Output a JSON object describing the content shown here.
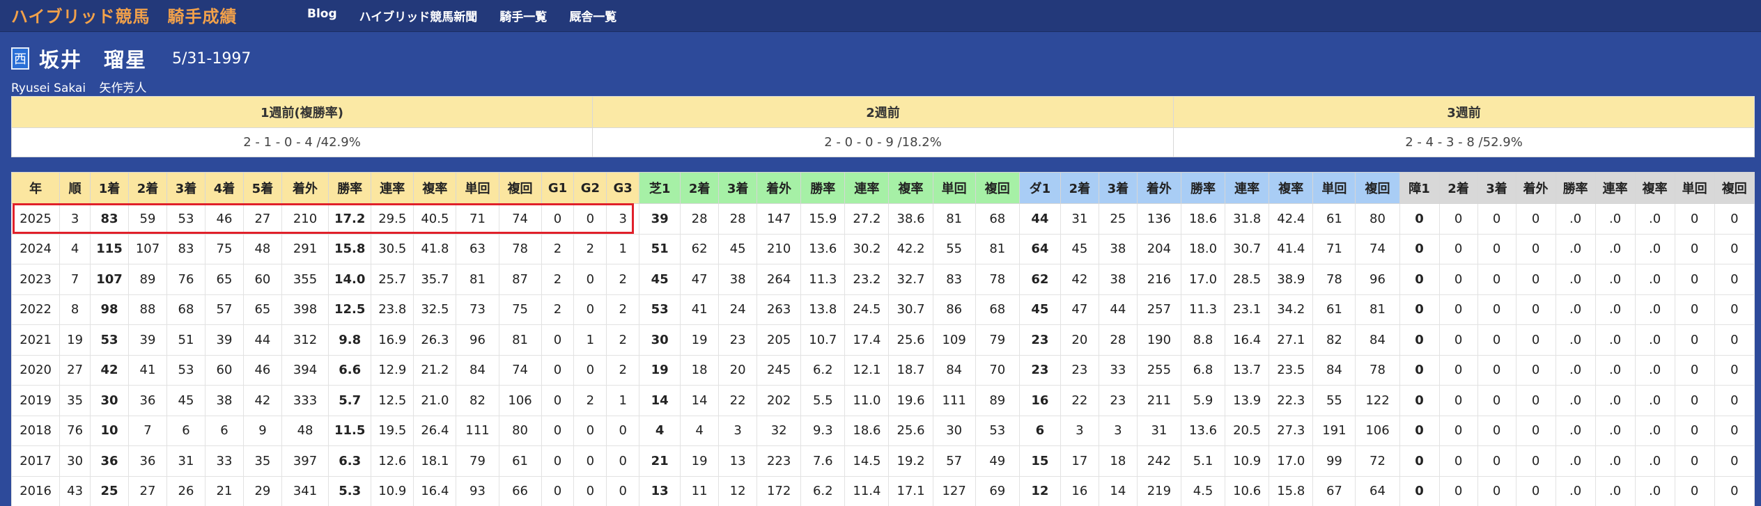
{
  "header": {
    "site_title": "ハイブリッド競馬　騎手成績",
    "nav": [
      "Blog",
      "ハイブリッド競馬新聞",
      "騎手一覧",
      "厩舎一覧"
    ]
  },
  "jockey": {
    "region_badge": "西",
    "name": "坂井　瑠星",
    "birth": "5/31-1997",
    "romaji": "Ryusei Sakai",
    "trainer": "矢作芳人"
  },
  "weeks": {
    "headers": [
      "1週前(複勝率)",
      "2週前",
      "3週前"
    ],
    "values": [
      "2 - 1 - 0 - 4 /42.9%",
      "2 - 0 - 0 - 9 /18.2%",
      "2 - 4 - 3 - 8 /52.9%"
    ]
  },
  "stats": {
    "headers": [
      "年",
      "順",
      "1着",
      "2着",
      "3着",
      "4着",
      "5着",
      "着外",
      "勝率",
      "連率",
      "複率",
      "単回",
      "複回",
      "G1",
      "G2",
      "G3",
      "芝1",
      "2着",
      "3着",
      "着外",
      "勝率",
      "連率",
      "複率",
      "単回",
      "複回",
      "ダ1",
      "2着",
      "3着",
      "着外",
      "勝率",
      "連率",
      "複率",
      "単回",
      "複回",
      "障1",
      "2着",
      "3着",
      "着外",
      "勝率",
      "連率",
      "複率",
      "単回",
      "複回"
    ],
    "rows": [
      [
        "2025",
        "3",
        "83",
        "59",
        "53",
        "46",
        "27",
        "210",
        "17.2",
        "29.5",
        "40.5",
        "71",
        "74",
        "0",
        "0",
        "3",
        "39",
        "28",
        "28",
        "147",
        "15.9",
        "27.2",
        "38.6",
        "81",
        "68",
        "44",
        "31",
        "25",
        "136",
        "18.6",
        "31.8",
        "42.4",
        "61",
        "80",
        "0",
        "0",
        "0",
        "0",
        ".0",
        ".0",
        ".0",
        "0",
        "0"
      ],
      [
        "2024",
        "4",
        "115",
        "107",
        "83",
        "75",
        "48",
        "291",
        "15.8",
        "30.5",
        "41.8",
        "63",
        "78",
        "2",
        "2",
        "1",
        "51",
        "62",
        "45",
        "210",
        "13.6",
        "30.2",
        "42.2",
        "55",
        "81",
        "64",
        "45",
        "38",
        "204",
        "18.0",
        "30.7",
        "41.4",
        "71",
        "74",
        "0",
        "0",
        "0",
        "0",
        ".0",
        ".0",
        ".0",
        "0",
        "0"
      ],
      [
        "2023",
        "7",
        "107",
        "89",
        "76",
        "65",
        "60",
        "355",
        "14.0",
        "25.7",
        "35.7",
        "81",
        "87",
        "2",
        "0",
        "2",
        "45",
        "47",
        "38",
        "264",
        "11.3",
        "23.2",
        "32.7",
        "83",
        "78",
        "62",
        "42",
        "38",
        "216",
        "17.0",
        "28.5",
        "38.9",
        "78",
        "96",
        "0",
        "0",
        "0",
        "0",
        ".0",
        ".0",
        ".0",
        "0",
        "0"
      ],
      [
        "2022",
        "8",
        "98",
        "88",
        "68",
        "57",
        "65",
        "398",
        "12.5",
        "23.8",
        "32.5",
        "73",
        "75",
        "2",
        "0",
        "2",
        "53",
        "41",
        "24",
        "263",
        "13.8",
        "24.5",
        "30.7",
        "86",
        "68",
        "45",
        "47",
        "44",
        "257",
        "11.3",
        "23.1",
        "34.2",
        "61",
        "81",
        "0",
        "0",
        "0",
        "0",
        ".0",
        ".0",
        ".0",
        "0",
        "0"
      ],
      [
        "2021",
        "19",
        "53",
        "39",
        "51",
        "39",
        "44",
        "312",
        "9.8",
        "16.9",
        "26.3",
        "96",
        "81",
        "0",
        "1",
        "2",
        "30",
        "19",
        "23",
        "205",
        "10.7",
        "17.4",
        "25.6",
        "109",
        "79",
        "23",
        "20",
        "28",
        "190",
        "8.8",
        "16.4",
        "27.1",
        "82",
        "84",
        "0",
        "0",
        "0",
        "0",
        ".0",
        ".0",
        ".0",
        "0",
        "0"
      ],
      [
        "2020",
        "27",
        "42",
        "41",
        "53",
        "60",
        "46",
        "394",
        "6.6",
        "12.9",
        "21.2",
        "84",
        "74",
        "0",
        "0",
        "2",
        "19",
        "18",
        "20",
        "245",
        "6.2",
        "12.1",
        "18.7",
        "84",
        "70",
        "23",
        "23",
        "33",
        "255",
        "6.8",
        "13.7",
        "23.5",
        "84",
        "78",
        "0",
        "0",
        "0",
        "0",
        ".0",
        ".0",
        ".0",
        "0",
        "0"
      ],
      [
        "2019",
        "35",
        "30",
        "36",
        "45",
        "38",
        "42",
        "333",
        "5.7",
        "12.5",
        "21.0",
        "82",
        "106",
        "0",
        "2",
        "1",
        "14",
        "14",
        "22",
        "202",
        "5.5",
        "11.0",
        "19.6",
        "111",
        "89",
        "16",
        "22",
        "23",
        "211",
        "5.9",
        "13.9",
        "22.3",
        "55",
        "122",
        "0",
        "0",
        "0",
        "0",
        ".0",
        ".0",
        ".0",
        "0",
        "0"
      ],
      [
        "2018",
        "76",
        "10",
        "7",
        "6",
        "6",
        "9",
        "48",
        "11.5",
        "19.5",
        "26.4",
        "111",
        "80",
        "0",
        "0",
        "0",
        "4",
        "4",
        "3",
        "32",
        "9.3",
        "18.6",
        "25.6",
        "30",
        "53",
        "6",
        "3",
        "3",
        "31",
        "13.6",
        "20.5",
        "27.3",
        "191",
        "106",
        "0",
        "0",
        "0",
        "0",
        ".0",
        ".0",
        ".0",
        "0",
        "0"
      ],
      [
        "2017",
        "30",
        "36",
        "36",
        "31",
        "33",
        "35",
        "397",
        "6.3",
        "12.6",
        "18.1",
        "79",
        "61",
        "0",
        "0",
        "0",
        "21",
        "19",
        "13",
        "223",
        "7.6",
        "14.5",
        "19.2",
        "57",
        "49",
        "15",
        "17",
        "18",
        "242",
        "5.1",
        "10.9",
        "17.0",
        "99",
        "72",
        "0",
        "0",
        "0",
        "0",
        ".0",
        ".0",
        ".0",
        "0",
        "0"
      ],
      [
        "2016",
        "43",
        "25",
        "27",
        "26",
        "21",
        "29",
        "341",
        "5.3",
        "10.9",
        "16.4",
        "93",
        "66",
        "0",
        "0",
        "0",
        "13",
        "11",
        "12",
        "172",
        "6.2",
        "11.4",
        "17.1",
        "127",
        "69",
        "12",
        "16",
        "14",
        "219",
        "4.5",
        "10.6",
        "15.8",
        "67",
        "64",
        "0",
        "0",
        "0",
        "0",
        ".0",
        ".0",
        ".0",
        "0",
        "0"
      ]
    ]
  }
}
